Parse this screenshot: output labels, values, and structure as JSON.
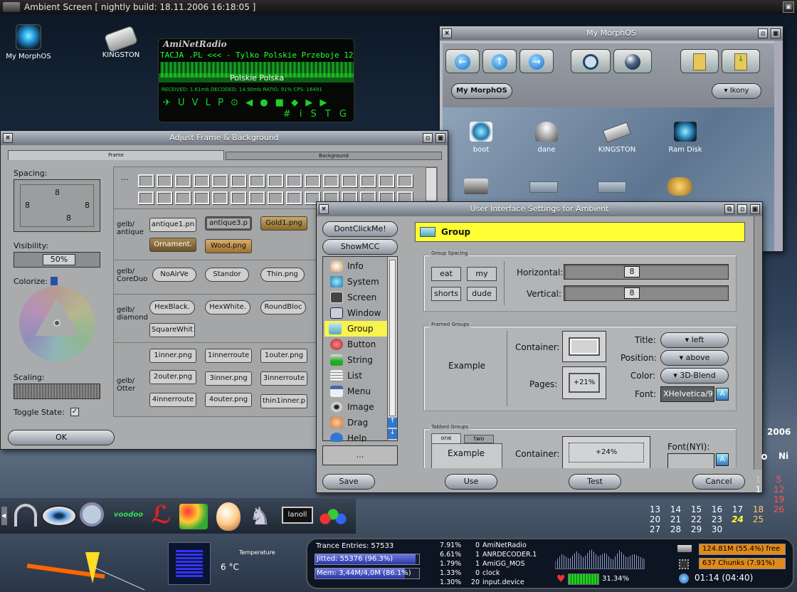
{
  "topbar": {
    "title": "Ambient Screen  [ nightly build: 18.11.2006 16:18:05 ]"
  },
  "colors": {
    "accent": "#ffff33",
    "radio_green": "#22ff33",
    "list_select": "#f8f34e"
  },
  "desktop_icons": [
    {
      "label": "My MorphOS",
      "icon": "butterfly-icon"
    },
    {
      "label": "KINGSTON",
      "icon": "usb-drive-icon"
    }
  ],
  "radio": {
    "title": "AmiNetRadio",
    "line1": "TACJA .PL <<< - Tylko Polskie Przeboje 128kbps",
    "line2": "Polskie Polska",
    "stats": "RECEIVED: 1.61mb   DECODED: 14.90mb   RATIO: 91%  CPS: 16491",
    "controls": "✈ U V L P  ⊙  ◀ ● ■ ◆  ▶ ▶",
    "controls2": "# i S T G"
  },
  "morphos_win": {
    "title": "My MorphOS",
    "path_label": "My MorphOS",
    "view_label": "Ikony",
    "drives": [
      {
        "label": "boot",
        "icon": "butterfly-drive-icon"
      },
      {
        "label": "dane",
        "icon": "harddisk-icon"
      },
      {
        "label": "KINGSTON",
        "icon": "usb-drive-icon"
      },
      {
        "label": "Ram Disk",
        "icon": "butterfly-icon"
      }
    ]
  },
  "adjust_win": {
    "title": "Adjust Frame & Background",
    "tabs": [
      "Frame",
      "Background"
    ],
    "spacing_label": "Spacing:",
    "spacing_top": "8",
    "spacing_left": "8",
    "spacing_right": "8",
    "spacing_bottom": "8",
    "visibility_label": "Visibility:",
    "visibility_value": "50%",
    "colorize_label": "Colorize:",
    "scaling_label": "Scaling:",
    "toggle_label": "Toggle State:",
    "ok_label": "OK",
    "ellipsis": "...",
    "groups": [
      {
        "name": "gelb/\nantique",
        "items": [
          "antique1.pn",
          "antique3.p",
          "Gold1.png",
          "Ornament.",
          "Wood.png"
        ]
      },
      {
        "name": "gelb/\nCoreDuo",
        "items": [
          "NoAirVe",
          "Standor",
          "Thin.png"
        ]
      },
      {
        "name": "gelb/\ndiamond",
        "items": [
          "HexBlack.",
          "HexWhite.",
          "RoundBloc",
          "SquareWhit"
        ]
      },
      {
        "name": "gelb/\nOtter",
        "items": [
          "1inner.png",
          "1innerroute",
          "1outer.png",
          "2outer.png",
          "3inner.png",
          "3innerroute",
          "4innerroute",
          "4outer.png",
          "thin1inner.p"
        ]
      }
    ]
  },
  "ui_win": {
    "title": "User Interface Settings for Ambient",
    "btn_dont": "DontClickMe!",
    "btn_mcc": "ShowMCC",
    "list": [
      {
        "label": "Info",
        "icon": "info-icon"
      },
      {
        "label": "System",
        "icon": "butterfly-icon"
      },
      {
        "label": "Screen",
        "icon": "screen-icon"
      },
      {
        "label": "Window",
        "icon": "window-icon"
      },
      {
        "label": "Group",
        "icon": "folder-icon"
      },
      {
        "label": "Button",
        "icon": "button-icon"
      },
      {
        "label": "String",
        "icon": "string-icon"
      },
      {
        "label": "List",
        "icon": "list-icon"
      },
      {
        "label": "Menu",
        "icon": "menu-icon"
      },
      {
        "label": "Image",
        "icon": "eye-icon"
      },
      {
        "label": "Drag",
        "icon": "hand-icon"
      },
      {
        "label": "Help",
        "icon": "help-icon"
      }
    ],
    "list_bottom": "...",
    "section_title": "Group",
    "group_spacing": {
      "title": "Group Spacing",
      "buttons": [
        "eat",
        "my",
        "shorts",
        "dude"
      ],
      "horizontal_label": "Horizontal:",
      "horizontal_value": "8",
      "vertical_label": "Vertical:",
      "vertical_value": "8"
    },
    "framed": {
      "title": "Framed Groups",
      "example": "Example",
      "container_label": "Container:",
      "pages_label": "Pages:",
      "pages_value": "+21%",
      "title_label": "Title:",
      "title_value": "left",
      "position_label": "Position:",
      "position_value": "above",
      "color_label": "Color:",
      "color_value": "3D-Blend",
      "font_label": "Font:",
      "font_value": "XHelvetica/9"
    },
    "tabbed": {
      "title": "Tabbed Groups",
      "tab_one": "one",
      "tab_two": "two",
      "example": "Example",
      "container_label": "Container:",
      "container_value": "+24%",
      "font_label": "Font(NYI):"
    },
    "footer": [
      "Save",
      "Use",
      "Test",
      "Cancel"
    ]
  },
  "calendar": {
    "year": "2006",
    "day_header": "Ni",
    "rows": [
      [
        "",
        "",
        "",
        "",
        "",
        "1",
        "5"
      ],
      [
        "",
        "",
        "",
        "",
        "",
        "1",
        "12"
      ],
      [
        "",
        "",
        "",
        "",
        "",
        "",
        "19"
      ],
      [
        "13",
        "14",
        "15",
        "16",
        "17",
        "18",
        "26"
      ],
      [
        "20",
        "21",
        "22",
        "23",
        "24",
        "25",
        ""
      ],
      [
        "27",
        "28",
        "29",
        "30",
        "",
        "",
        ""
      ]
    ],
    "today": "24"
  },
  "dock_icons": [
    "headphones-icon",
    "eye-icon",
    "magnifier-icon",
    "voodoo-icon",
    "pdf-icon",
    "paint-icon",
    "egg-icon",
    "knight-icon",
    "terminal-icon",
    "balls-icon"
  ],
  "status": {
    "temperature_label": "Temperature",
    "temperature_value": "6 °C",
    "trance_entries": "Trance Entries: 57533",
    "jitted": "Jitted: 55376 (96.3%)",
    "mem": "Mem: 3,44M/4,0M (86.1%)",
    "jitted_fill": 0.963,
    "mem_fill": 0.861,
    "processes": [
      {
        "pct": "7.91%",
        "pri": "0",
        "name": "AmiNetRadio"
      },
      {
        "pct": "6.61%",
        "pri": "1",
        "name": "ANRDECODER.1"
      },
      {
        "pct": "1.79%",
        "pri": "1",
        "name": "AmiGG_MOS"
      },
      {
        "pct": "1.33%",
        "pri": "0",
        "name": "clock"
      },
      {
        "pct": "1.30%",
        "pri": "20",
        "name": "input.device"
      }
    ],
    "cpu_value": "31.34%",
    "cpu_fill": 0.3134,
    "mem_free": "124.81M (55.4%) free",
    "mem_free_fill": 0.554,
    "chunks": "637 Chunks (7.91%)",
    "chunks_fill": 0.0791,
    "uptime": "01:14 (04:40)"
  }
}
